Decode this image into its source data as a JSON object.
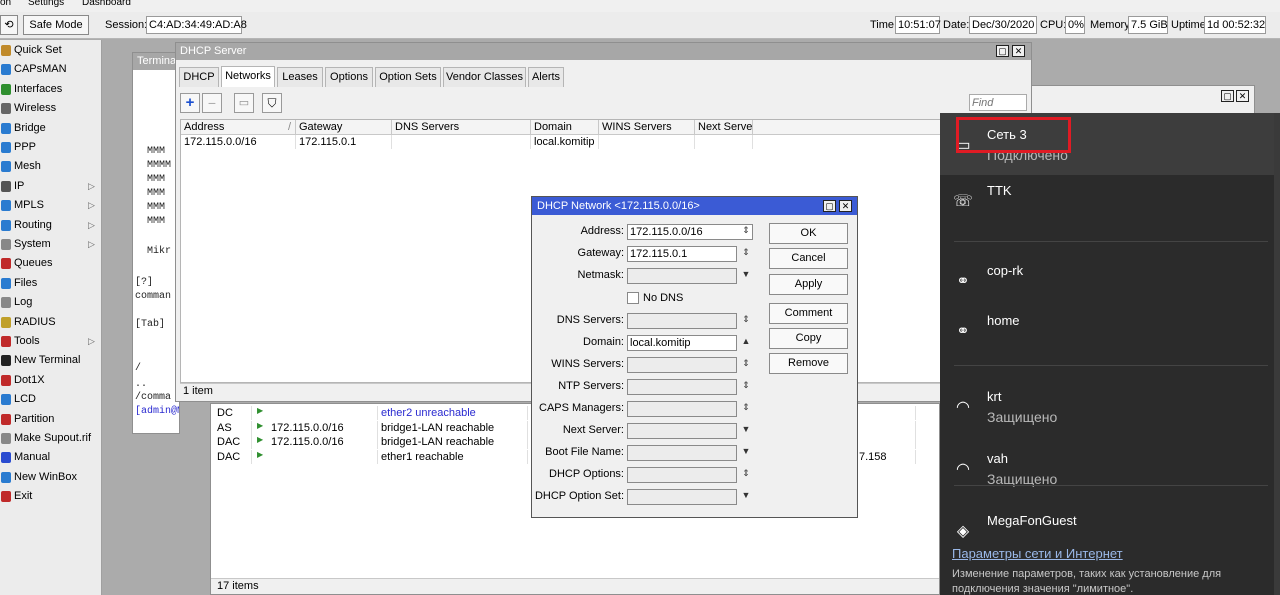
{
  "top_menu": [
    "on",
    "Settings",
    "Dashboard"
  ],
  "toolbar": {
    "safe_mode": "Safe Mode",
    "session_label": "Session:",
    "session_value": "C4:AD:34:49:AD:A8",
    "time_label": "Time:",
    "time_value": "10:51:07",
    "date_label": "Date:",
    "date_value": "Dec/30/2020",
    "cpu_label": "CPU:",
    "cpu_value": "0%",
    "memory_label": "Memory:",
    "memory_value": "7.5 GiB",
    "uptime_label": "Uptime:",
    "uptime_value": "1d 00:52:32"
  },
  "sidebar": {
    "items": [
      {
        "label": "Quick Set",
        "icon": "wand-icon",
        "color": "#c08a2a",
        "arrow": false
      },
      {
        "label": "CAPsMAN",
        "icon": "antenna-icon",
        "color": "#2a7bd0",
        "arrow": false
      },
      {
        "label": "Interfaces",
        "icon": "interfaces-icon",
        "color": "#2f8f2f",
        "arrow": false
      },
      {
        "label": "Wireless",
        "icon": "wireless-icon",
        "color": "#666666",
        "arrow": false
      },
      {
        "label": "Bridge",
        "icon": "bridge-icon",
        "color": "#2a7bd0",
        "arrow": false
      },
      {
        "label": "PPP",
        "icon": "ppp-icon",
        "color": "#2a7bd0",
        "arrow": false
      },
      {
        "label": "Mesh",
        "icon": "mesh-icon",
        "color": "#2a7bd0",
        "arrow": false
      },
      {
        "label": "IP",
        "icon": "ip-icon",
        "color": "#555555",
        "arrow": true
      },
      {
        "label": "MPLS",
        "icon": "mpls-icon",
        "color": "#2a7bd0",
        "arrow": true
      },
      {
        "label": "Routing",
        "icon": "routing-icon",
        "color": "#2a7bd0",
        "arrow": true
      },
      {
        "label": "System",
        "icon": "gear-icon",
        "color": "#888888",
        "arrow": true
      },
      {
        "label": "Queues",
        "icon": "queues-icon",
        "color": "#c02a2a",
        "arrow": false
      },
      {
        "label": "Files",
        "icon": "files-icon",
        "color": "#2a7bd0",
        "arrow": false
      },
      {
        "label": "Log",
        "icon": "log-icon",
        "color": "#888888",
        "arrow": false
      },
      {
        "label": "RADIUS",
        "icon": "radius-icon",
        "color": "#c0a02a",
        "arrow": false
      },
      {
        "label": "Tools",
        "icon": "tools-icon",
        "color": "#c02a2a",
        "arrow": true
      },
      {
        "label": "New Terminal",
        "icon": "terminal-icon",
        "color": "#222222",
        "arrow": false
      },
      {
        "label": "Dot1X",
        "icon": "dot1x-icon",
        "color": "#c02a2a",
        "arrow": false
      },
      {
        "label": "LCD",
        "icon": "lcd-icon",
        "color": "#2a7bd0",
        "arrow": false
      },
      {
        "label": "Partition",
        "icon": "partition-icon",
        "color": "#c02a2a",
        "arrow": false
      },
      {
        "label": "Make Supout.rif",
        "icon": "supout-icon",
        "color": "#888888",
        "arrow": false
      },
      {
        "label": "Manual",
        "icon": "manual-icon",
        "color": "#2a4bd0",
        "arrow": false
      },
      {
        "label": "New WinBox",
        "icon": "winbox-icon",
        "color": "#2a7bd0",
        "arrow": false
      },
      {
        "label": "Exit",
        "icon": "exit-icon",
        "color": "#c02a2a",
        "arrow": false
      }
    ]
  },
  "terminal": {
    "title": "Termina",
    "lines": [
      "MMM",
      "MMMM",
      "MMM",
      "MMM",
      "MMM",
      "MMM",
      "Mikr",
      "[?]",
      "comman",
      "[Tab]",
      "/",
      "..",
      "/comma",
      "[admin@Mikr"
    ]
  },
  "dhcp_window": {
    "title": "DHCP Server",
    "tabs": [
      "DHCP",
      "Networks",
      "Leases",
      "Options",
      "Option Sets",
      "Vendor Classes",
      "Alerts"
    ],
    "active_tab": "Networks",
    "find_placeholder": "Find",
    "columns": [
      "Address",
      "Gateway",
      "DNS Servers",
      "Domain",
      "WINS Servers",
      "Next Server"
    ],
    "rows": [
      {
        "address": "172.115.0.0/16",
        "gateway": "172.115.0.1",
        "dns": "",
        "domain": "local.komitip",
        "wins": "",
        "next": ""
      }
    ],
    "status": "1 item"
  },
  "routes_window": {
    "rows": [
      {
        "flag": "DC",
        "dst": "",
        "gateway": "ether2 unreachable",
        "extra": ""
      },
      {
        "flag": "AS",
        "dst": "172.115.0.0/16",
        "gateway": "bridge1-LAN reachable",
        "extra": ""
      },
      {
        "flag": "DAC",
        "dst": "172.115.0.0/16",
        "gateway": "bridge1-LAN reachable",
        "extra": ""
      },
      {
        "flag": "DAC",
        "dst": "",
        "gateway": "ether1 reachable",
        "extra": "7.158"
      }
    ],
    "status": "17 items"
  },
  "dhcp_network_dialog": {
    "title": "DHCP Network <172.115.0.0/16>",
    "fields": [
      {
        "label": "Address:",
        "value": "172.115.0.0/16"
      },
      {
        "label": "Gateway:",
        "value": "172.115.0.1"
      },
      {
        "label": "Netmask:",
        "value": ""
      },
      {
        "label": "",
        "value": ""
      },
      {
        "label": "DNS Servers:",
        "value": ""
      },
      {
        "label": "Domain:",
        "value": "local.komitip"
      },
      {
        "label": "WINS Servers:",
        "value": ""
      },
      {
        "label": "NTP Servers:",
        "value": ""
      },
      {
        "label": "CAPS Managers:",
        "value": ""
      },
      {
        "label": "Next Server:",
        "value": ""
      },
      {
        "label": "Boot File Name:",
        "value": ""
      },
      {
        "label": "DHCP Options:",
        "value": ""
      },
      {
        "label": "DHCP Option Set:",
        "value": ""
      }
    ],
    "no_dns_label": "No DNS",
    "buttons": [
      "OK",
      "Cancel",
      "Apply",
      "Comment",
      "Copy",
      "Remove"
    ]
  },
  "wifi_panel": {
    "networks": [
      {
        "name": "Сеть 3",
        "status": "Подключено",
        "icon": "ethernet-icon"
      },
      {
        "name": "TTK",
        "status": "",
        "icon": "dialup-icon"
      },
      {
        "name": "cop-rk",
        "status": "",
        "icon": "hotspot-icon"
      },
      {
        "name": "home",
        "status": "",
        "icon": "hotspot-icon"
      },
      {
        "name": "krt",
        "status": "Защищено",
        "icon": "wifi-icon"
      },
      {
        "name": "vah",
        "status": "Защищено",
        "icon": "wifi-icon"
      },
      {
        "name": "MegaFonGuest",
        "status": "",
        "icon": "wifi-open-icon"
      }
    ],
    "settings_link": "Параметры сети и Интернет",
    "settings_desc_1": "Изменение параметров, таких как установление для",
    "settings_desc_2": "подключения значения \"лимитное\".",
    "highlight_color": "#e01b24"
  }
}
